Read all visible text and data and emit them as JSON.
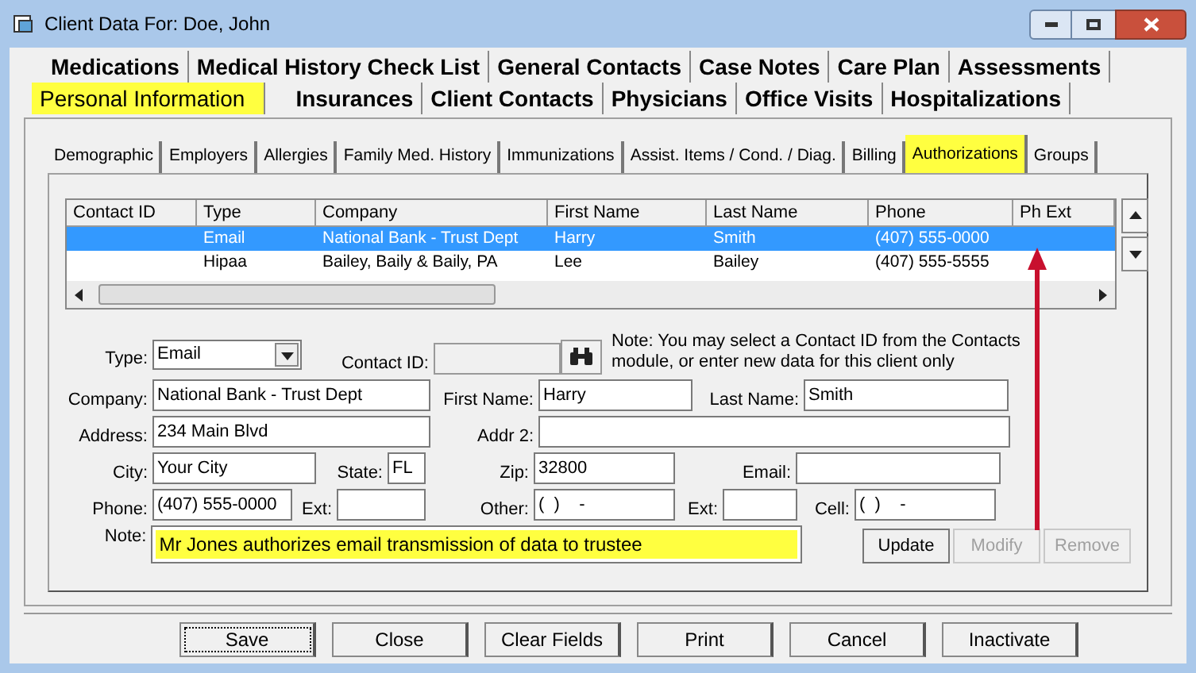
{
  "window": {
    "title": "Client Data For: Doe, John"
  },
  "main_tab_rows": [
    {
      "tabs": [
        {
          "label": "Medications",
          "selected": false,
          "highlighted": false
        },
        {
          "label": "Medical History Check List",
          "selected": false,
          "highlighted": false
        },
        {
          "label": "General Contacts",
          "selected": false,
          "highlighted": false
        },
        {
          "label": "Case Notes",
          "selected": false,
          "highlighted": false
        },
        {
          "label": "Care Plan",
          "selected": false,
          "highlighted": false
        },
        {
          "label": "Assessments",
          "selected": false,
          "highlighted": false
        }
      ]
    },
    {
      "tabs": [
        {
          "label": "Personal Information",
          "selected": true,
          "highlighted": true
        },
        {
          "label": "Insurances",
          "selected": false,
          "highlighted": false
        },
        {
          "label": "Client Contacts",
          "selected": false,
          "highlighted": false
        },
        {
          "label": "Physicians",
          "selected": false,
          "highlighted": false
        },
        {
          "label": "Office Visits",
          "selected": false,
          "highlighted": false
        },
        {
          "label": "Hospitalizations",
          "selected": false,
          "highlighted": false
        }
      ]
    }
  ],
  "sub_tabs": [
    {
      "label": "Demographic",
      "selected": false,
      "highlighted": false
    },
    {
      "label": "Employers",
      "selected": false,
      "highlighted": false
    },
    {
      "label": "Allergies",
      "selected": false,
      "highlighted": false
    },
    {
      "label": "Family Med. History",
      "selected": false,
      "highlighted": false
    },
    {
      "label": "Immunizations",
      "selected": false,
      "highlighted": false
    },
    {
      "label": "Assist. Items / Cond. / Diag.",
      "selected": false,
      "highlighted": false
    },
    {
      "label": "Billing",
      "selected": false,
      "highlighted": false
    },
    {
      "label": "Authorizations",
      "selected": true,
      "highlighted": true
    },
    {
      "label": "Groups",
      "selected": false,
      "highlighted": false
    }
  ],
  "table": {
    "columns": [
      "Contact ID",
      "Type",
      "Company",
      "First Name",
      "Last Name",
      "Phone",
      "Ph Ext"
    ],
    "rows": [
      {
        "selected": true,
        "cells": [
          "",
          "Email",
          "National Bank - Trust Dept",
          "Harry",
          "Smith",
          "(407) 555-0000",
          ""
        ]
      },
      {
        "selected": false,
        "cells": [
          "",
          "Hipaa",
          "Bailey, Baily & Baily, PA",
          "Lee",
          "Bailey",
          "(407) 555-5555",
          ""
        ]
      }
    ]
  },
  "form": {
    "type": {
      "label": "Type:",
      "value": "Email"
    },
    "contact_id": {
      "label": "Contact ID:"
    },
    "note_text": "Note: You may select a Contact ID from the Contacts module, or enter new data for this client only",
    "rows": [
      [
        {
          "label": "Company:",
          "value": "National Bank - Trust Dept"
        },
        {
          "label": "First Name:",
          "value": "Harry"
        },
        {
          "label": "Last Name:",
          "value": "Smith"
        }
      ],
      [
        {
          "label": "Address:",
          "value": "234 Main Blvd"
        },
        {
          "label": "Addr 2:"
        }
      ],
      [
        {
          "label": "City:",
          "value": "Your City"
        },
        {
          "label": "State:",
          "value": "FL"
        },
        {
          "label": "Zip:",
          "value": "32800"
        },
        {
          "label": "Email:"
        }
      ],
      [
        {
          "label": "Phone:",
          "value": "(407) 555-0000"
        },
        {
          "label": "Ext:"
        },
        {
          "label": "Other:",
          "value": "(  )    -"
        },
        {
          "label": "Ext:"
        },
        {
          "label": "Cell:",
          "value": "(  )    -"
        }
      ]
    ],
    "note": {
      "label": "Note:",
      "value": "Mr Jones authorizes email transmission of data to trustee",
      "highlighted": true
    },
    "buttons": [
      {
        "label": "Update",
        "disabled": false
      },
      {
        "label": "Modify",
        "disabled": true
      },
      {
        "label": "Remove",
        "disabled": true
      }
    ]
  },
  "footer_buttons": [
    {
      "label": "Save",
      "focused": true
    },
    {
      "label": "Close",
      "focused": false
    },
    {
      "label": "Clear Fields",
      "focused": false
    },
    {
      "label": "Print",
      "focused": false
    },
    {
      "label": "Cancel",
      "focused": false
    },
    {
      "label": "Inactivate",
      "focused": false
    }
  ]
}
